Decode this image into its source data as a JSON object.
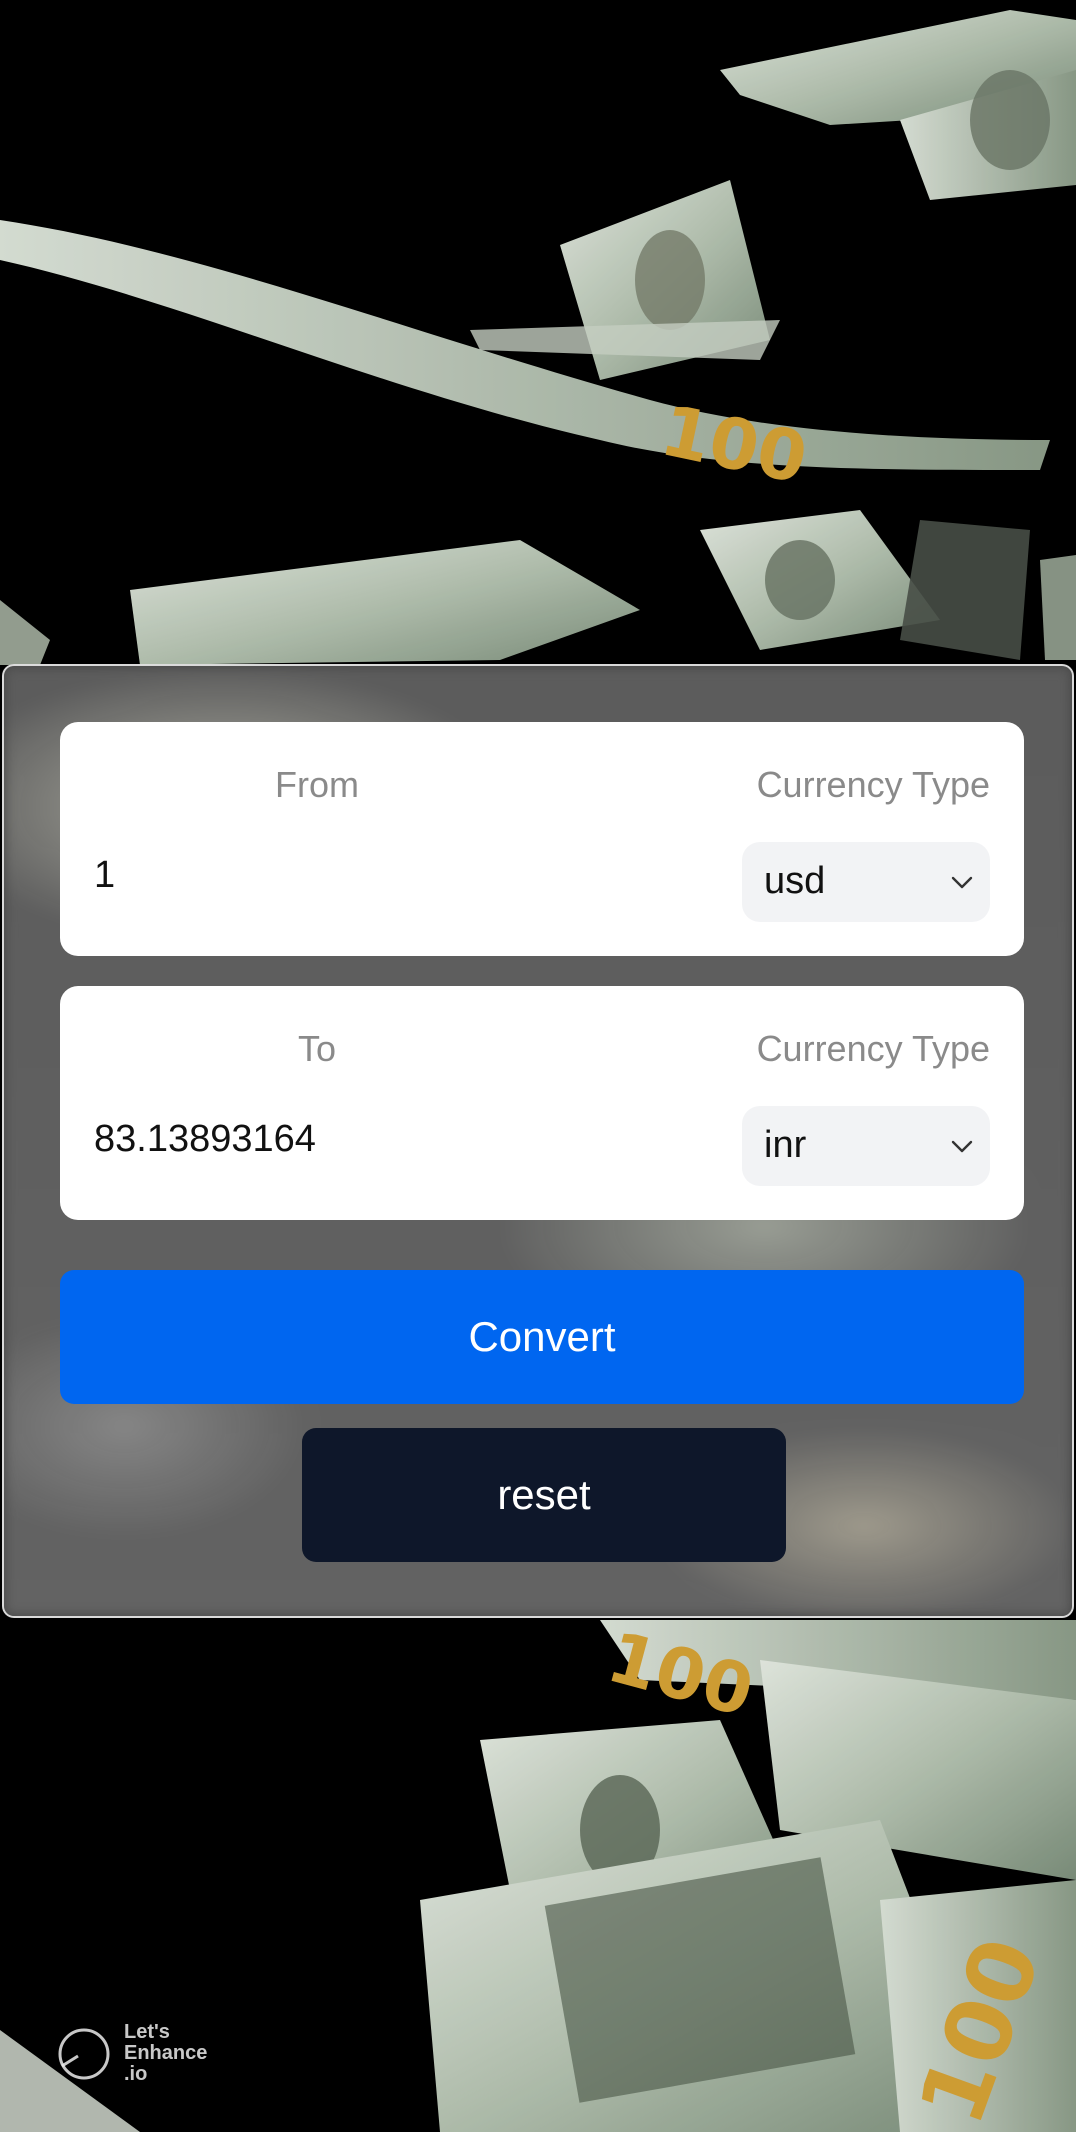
{
  "from_card": {
    "label": "From",
    "currency_label": "Currency Type",
    "amount": "1",
    "currency": "usd"
  },
  "to_card": {
    "label": "To",
    "currency_label": "Currency Type",
    "amount": "83.13893164",
    "currency": "inr"
  },
  "actions": {
    "convert_label": "Convert",
    "reset_label": "reset"
  },
  "watermark": {
    "text": "Let's Enhance .io"
  },
  "colors": {
    "convert_button": "#0066f0",
    "reset_button": "#0e172a",
    "card_background": "#ffffff",
    "page_background": "#000000"
  },
  "icons": {
    "select_arrow": "chevron-down-icon",
    "watermark_logo": "circle-logo-icon"
  }
}
